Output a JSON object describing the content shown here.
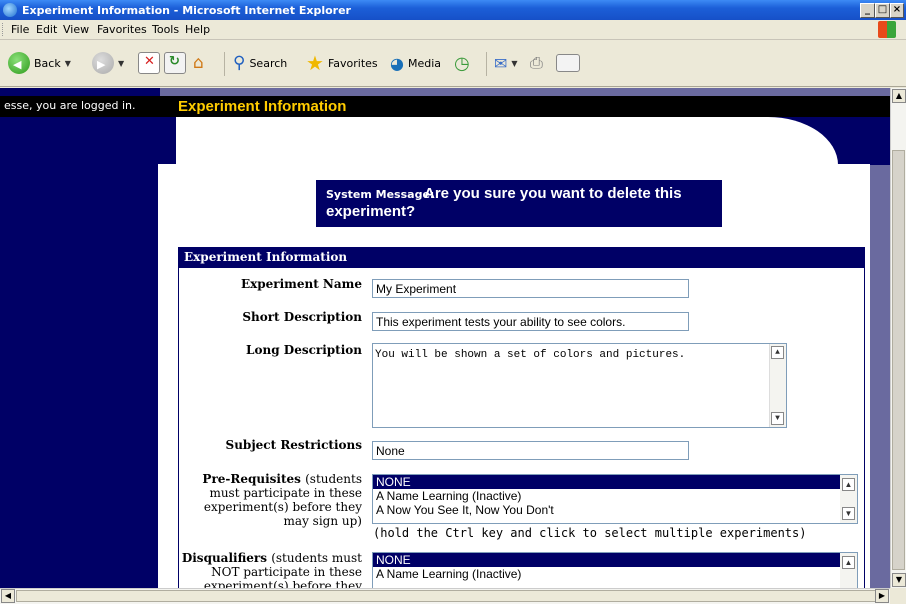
{
  "window": {
    "title": "Experiment Information - Microsoft Internet Explorer"
  },
  "menu": [
    "File",
    "Edit",
    "View",
    "Favorites",
    "Tools",
    "Help"
  ],
  "toolbar": {
    "back": "Back",
    "search": "Search",
    "favorites": "Favorites",
    "media": "Media"
  },
  "header": {
    "logged_in": "esse, you are logged in.",
    "page_title": "Experiment Information"
  },
  "system_message": {
    "label": "System Message:",
    "text": "Are you sure you want to delete this experiment?"
  },
  "form": {
    "section_title": "Experiment Information",
    "name_label": "Experiment Name",
    "name_value": "My Experiment",
    "short_label": "Short Description",
    "short_value": "This experiment tests your ability to see colors.",
    "long_label": "Long Description",
    "long_value": "You will be shown a set of colors and pictures.",
    "restrict_label": "Subject Restrictions",
    "restrict_value": "None",
    "prereq_label": "Pre-Requisites",
    "prereq_note": "(students must participate in these experiment(s) before they may sign up)",
    "prereq_options": [
      "NONE",
      "A Name Learning (Inactive)",
      "A Now You See It, Now You Don't"
    ],
    "multi_hint": "(hold the Ctrl key and click to select multiple experiments)",
    "disq_label": "Disqualifiers",
    "disq_note": "(students must NOT participate in these experiment(s) before they",
    "disq_options": [
      "NONE",
      "A Name Learning (Inactive)"
    ]
  }
}
